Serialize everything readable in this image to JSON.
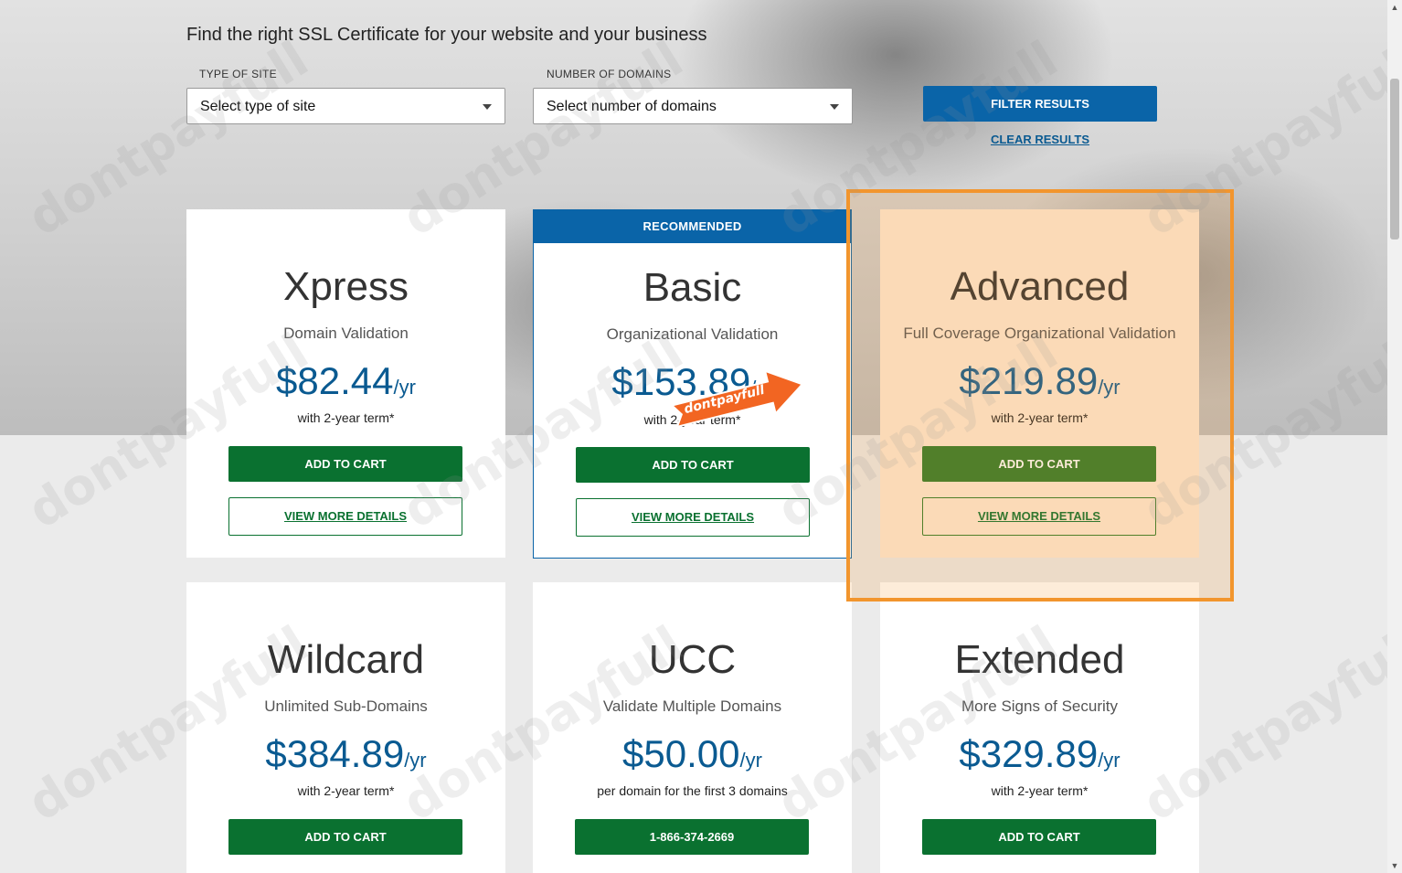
{
  "page": {
    "headline": "Find the right SSL Certificate for your website and your business"
  },
  "filters": {
    "type_of_site": {
      "label": "TYPE OF SITE",
      "value": "Select type of site"
    },
    "number_of_domains": {
      "label": "NUMBER OF DOMAINS",
      "value": "Select number of domains"
    },
    "filter_button": "FILTER RESULTS",
    "clear_link": "CLEAR RESULTS"
  },
  "cards": [
    {
      "title": "Xpress",
      "subtitle": "Domain Validation",
      "price": "$82.44",
      "unit": "/yr",
      "term": "with 2-year term*",
      "primary": "ADD TO CART",
      "secondary": "VIEW MORE DETAILS"
    },
    {
      "banner": "RECOMMENDED",
      "title": "Basic",
      "subtitle": "Organizational Validation",
      "price": "$153.89",
      "unit": "/yr",
      "term": "with 2-year term*",
      "primary": "ADD TO CART",
      "secondary": "VIEW MORE DETAILS"
    },
    {
      "title": "Advanced",
      "subtitle": "Full Coverage Organizational Validation",
      "price": "$219.89",
      "unit": "/yr",
      "term": "with 2-year term*",
      "primary": "ADD TO CART",
      "secondary": "VIEW MORE DETAILS"
    },
    {
      "title": "Wildcard",
      "subtitle": "Unlimited Sub-Domains",
      "price": "$384.89",
      "unit": "/yr",
      "term": "with 2-year term*",
      "primary": "ADD TO CART"
    },
    {
      "title": "UCC",
      "subtitle": "Validate Multiple Domains",
      "price": "$50.00",
      "unit": "/yr",
      "term": "per domain for the first 3 domains",
      "primary": "1-866-374-2669"
    },
    {
      "title": "Extended",
      "subtitle": "More Signs of Security",
      "price": "$329.89",
      "unit": "/yr",
      "term": "with 2-year term*",
      "primary": "ADD TO CART"
    }
  ],
  "overlay": {
    "promo_arrow_text": "dontpayfull",
    "watermark_text": "dontpayfull"
  },
  "colors": {
    "brand_blue": "#0a64a8",
    "cart_green": "#0a7130",
    "highlight_orange": "#f2952d"
  }
}
